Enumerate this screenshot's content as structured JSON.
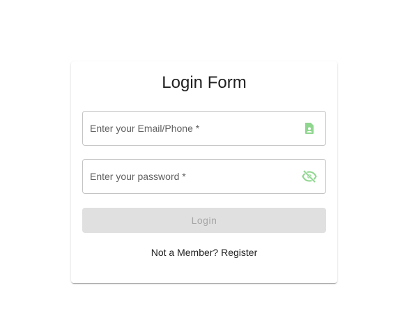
{
  "form": {
    "title": "Login Form",
    "email": {
      "placeholder": "Enter your Email/Phone *",
      "value": "",
      "icon": "contact-card-icon"
    },
    "password": {
      "placeholder": "Enter your password *",
      "value": "",
      "icon": "visibility-off-icon"
    },
    "login_label": "Login",
    "register_prompt": "Not a Member?",
    "register_link": "Register"
  },
  "colors": {
    "icon_accent": "#8fd68f",
    "button_disabled_bg": "#e0e0e0",
    "button_disabled_text": "#a6a6a6",
    "title_text": "#212121"
  }
}
